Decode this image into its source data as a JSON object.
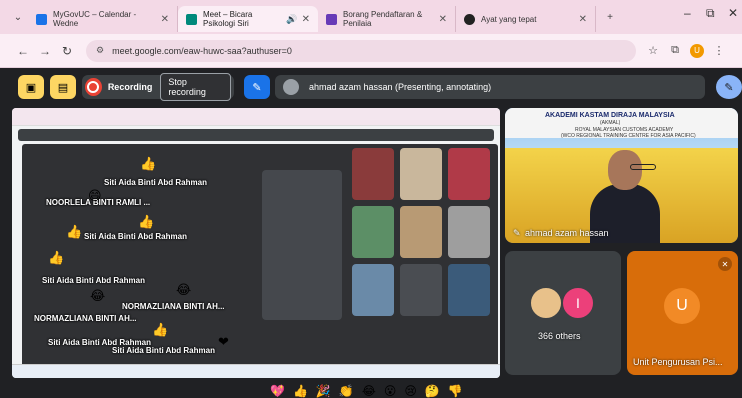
{
  "tabs": [
    {
      "label": "MyGovUC – Calendar - Wedne",
      "color": "#1a73e8",
      "active": false
    },
    {
      "label": "Meet – Bicara Psikologi Siri",
      "color": "#00897b",
      "active": true
    },
    {
      "label": "Borang Pendaftaran & Penilaia",
      "color": "#673ab7",
      "active": false
    },
    {
      "label": "Ayat yang tepat",
      "color": "#222222",
      "active": false
    }
  ],
  "address": {
    "url": "meet.google.com/eaw-huwc-saa?authuser=0"
  },
  "meet": {
    "recording_label": "Recording",
    "stop_recording": "Stop recording",
    "presenting_text": "ahmad azam hassan (Presenting, annotating)"
  },
  "overlay_names": [
    "Siti Aida Binti Abd Rahman",
    "NOORLELA BINTI RAMLI ...",
    "Siti Aida Binti Abd Rahman",
    "Siti Aida Binti Abd Rahman",
    "NORMAZLIANA BINTI AH...",
    "NORMAZLIANA BINTI AH...",
    "Siti Aida Binti Abd Rahman",
    "Siti Aida Binti Abd Rahman"
  ],
  "tiles": {
    "camera_name": "ahmad azam hassan",
    "banner_title": "AKADEMI KASTAM DIRAJA MALAYSIA",
    "banner_abbr": "(AKMAL)",
    "banner_sub1": "ROYAL MALAYSIAN CUSTOMS ACADEMY",
    "banner_sub2": "(WCO REGIONAL TRAINING CENTRE FOR ASIA PACIFIC)",
    "others_avatar_letter": "I",
    "others_label": "366 others",
    "unit_letter": "U",
    "unit_name": "Unit Pengurusan Psi..."
  },
  "colors": {
    "record_red": "#ea4335",
    "unit_orange": "#d86d0a",
    "others_pink": "#ec407a",
    "meet_bg": "#202124"
  }
}
